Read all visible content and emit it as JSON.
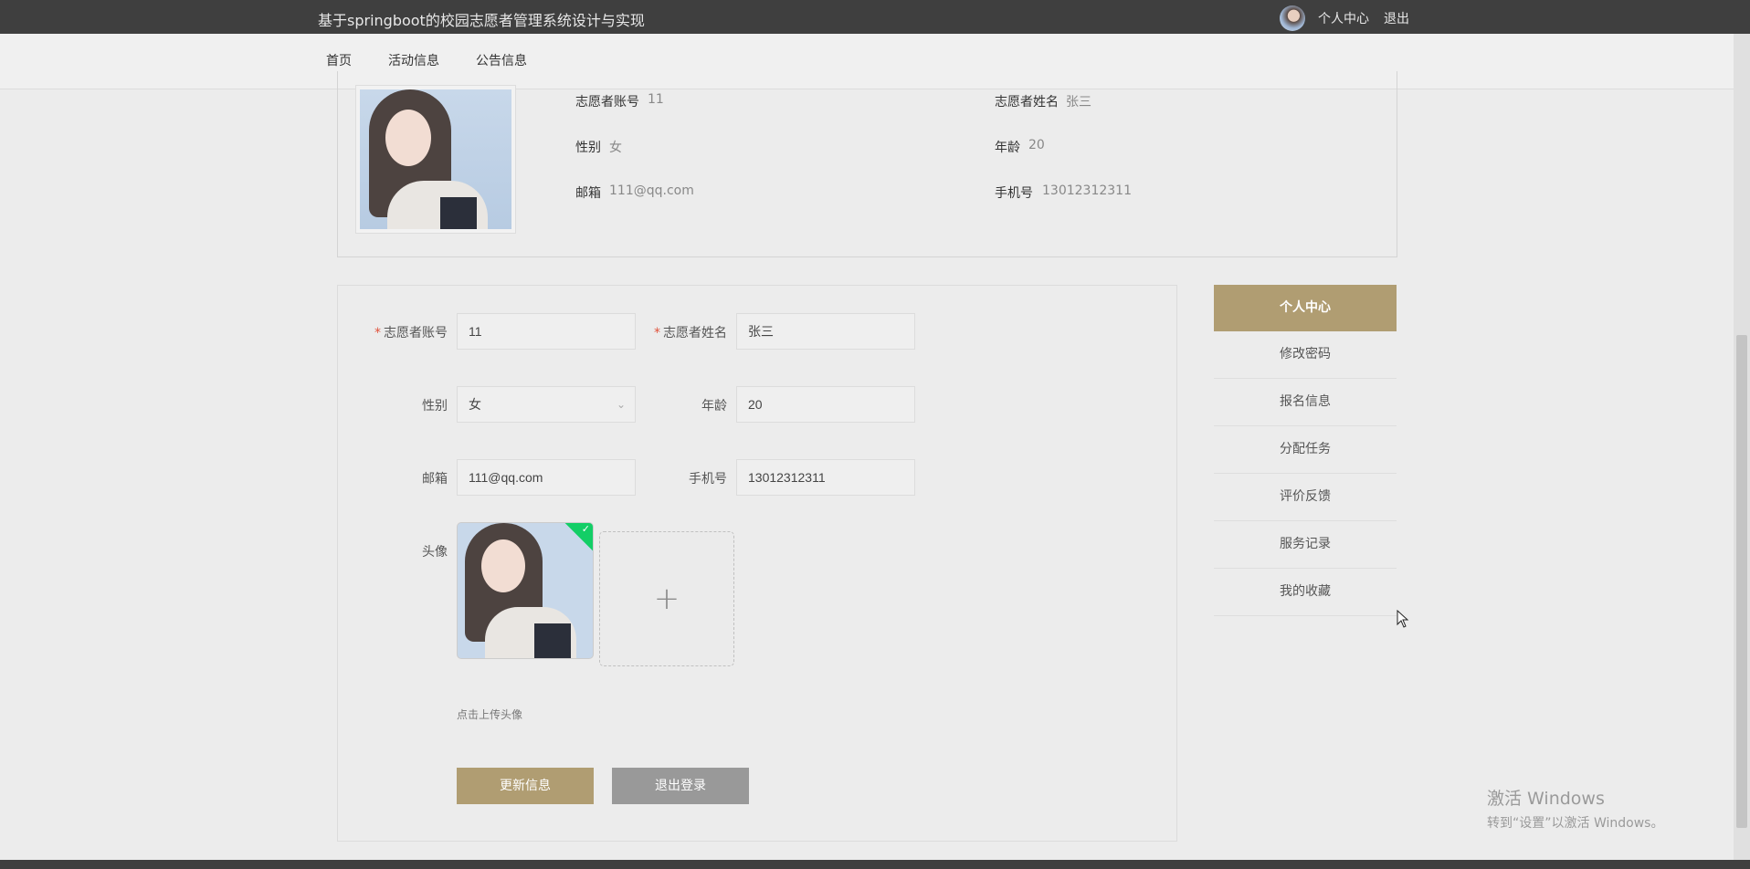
{
  "header": {
    "site_title": "基于springboot的校园志愿者管理系统设计与实现",
    "profile_link": "个人中心",
    "logout_link": "退出"
  },
  "nav": {
    "items": [
      "首页",
      "活动信息",
      "公告信息"
    ]
  },
  "info": {
    "account_label": "志愿者账号",
    "account_value": "11",
    "name_label": "志愿者姓名",
    "name_value": "张三",
    "gender_label": "性别",
    "gender_value": "女",
    "age_label": "年龄",
    "age_value": "20",
    "email_label": "邮箱",
    "email_value": "111@qq.com",
    "phone_label": "手机号",
    "phone_value": "13012312311"
  },
  "form": {
    "account_label": "志愿者账号",
    "account_value": "11",
    "name_label": "志愿者姓名",
    "name_value": "张三",
    "gender_label": "性别",
    "gender_value": "女",
    "age_label": "年龄",
    "age_value": "20",
    "email_label": "邮箱",
    "email_value": "111@qq.com",
    "phone_label": "手机号",
    "phone_value": "13012312311",
    "avatar_label": "头像",
    "upload_hint": "点击上传头像",
    "update_button": "更新信息",
    "logout_button": "退出登录",
    "required_mark": "*"
  },
  "side_menu": {
    "items": [
      "个人中心",
      "修改密码",
      "报名信息",
      "分配任务",
      "评价反馈",
      "服务记录",
      "我的收藏"
    ]
  },
  "watermark": {
    "line1": "激活 Windows",
    "line2": "转到“设置”以激活 Windows。"
  },
  "colors": {
    "accent": "#b09d72",
    "topbar": "#3f3f3f",
    "required": "#e0533d",
    "success": "#13ce66"
  },
  "icons": {
    "select_arrow": "chevron-down-icon",
    "upload": "plus-icon",
    "uploaded": "check-icon",
    "cursor": "mouse-pointer-icon"
  }
}
